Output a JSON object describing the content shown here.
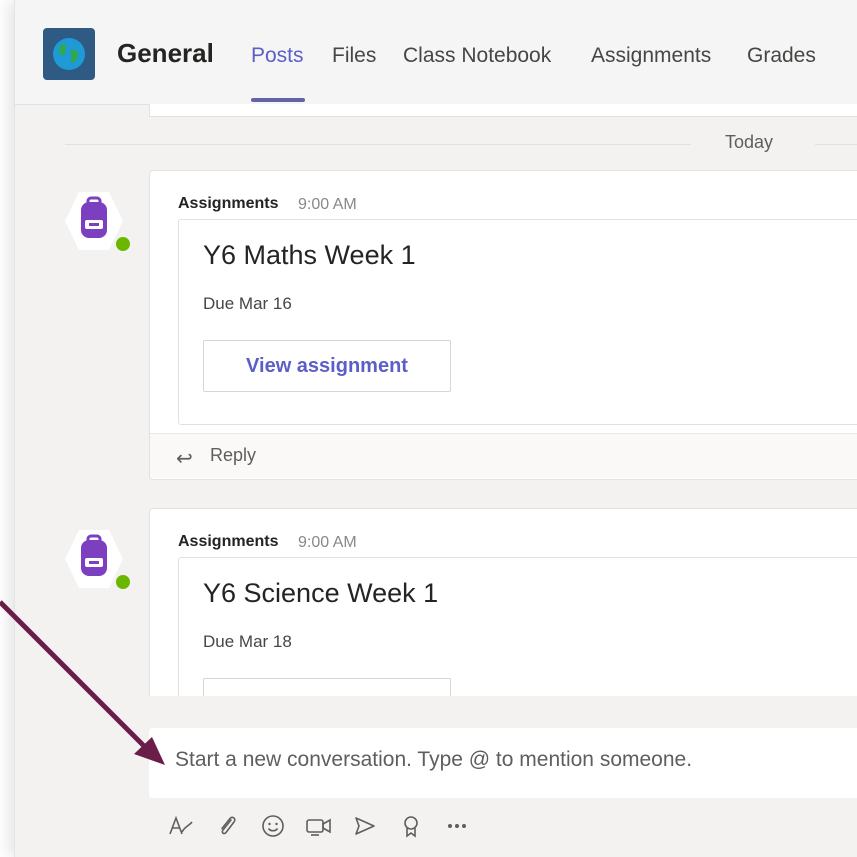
{
  "header": {
    "channel_name": "General",
    "tabs": [
      {
        "label": "Posts",
        "active": true
      },
      {
        "label": "Files"
      },
      {
        "label": "Class Notebook"
      },
      {
        "label": "Assignments"
      },
      {
        "label": "Grades"
      }
    ]
  },
  "date_divider": "Today",
  "messages": [
    {
      "sender": "Assignments",
      "time": "9:00 AM",
      "card": {
        "title": "Y6 Maths Week 1",
        "due": "Due Mar 16",
        "button": "View assignment"
      },
      "reply": "Reply"
    },
    {
      "sender": "Assignments",
      "time": "9:00 AM",
      "card": {
        "title": "Y6 Science Week 1",
        "due": "Due Mar 18"
      }
    }
  ],
  "compose": {
    "placeholder": "Start a new conversation. Type @ to mention someone."
  },
  "toolbar_icons": [
    "format-icon",
    "attach-icon",
    "emoji-icon",
    "meet-now-icon",
    "send-forward-icon",
    "praise-icon",
    "more-options-icon"
  ],
  "colors": {
    "accent": "#6264a7",
    "avatar": "#7b3fbf",
    "online": "#6bb700",
    "arrow": "#6b1d49",
    "team_tile": "#2f5a83"
  }
}
